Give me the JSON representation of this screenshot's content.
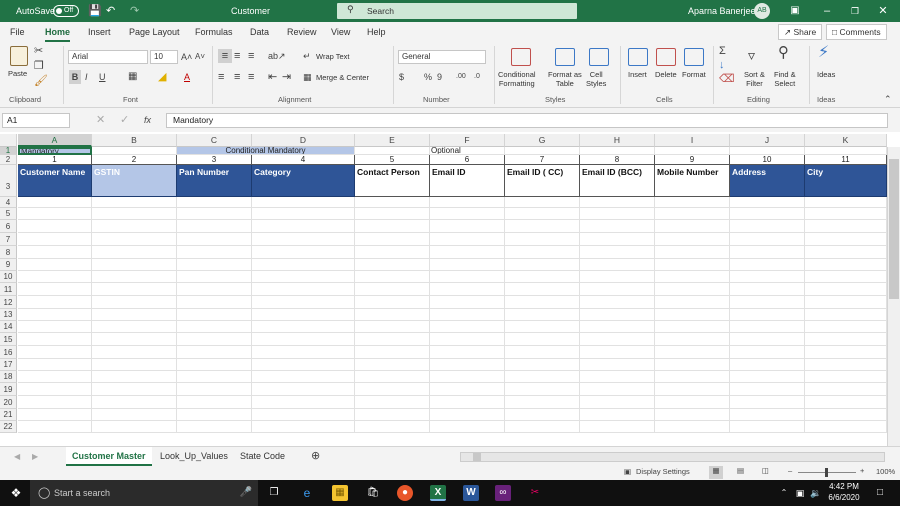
{
  "titlebar": {
    "autosave_label": "AutoSave",
    "autosave_state": "Off",
    "doc_title": "Customer",
    "search_placeholder": "Search",
    "user_name": "Aparna Banerjee",
    "user_initials": "AB"
  },
  "ribbon_tabs": [
    "File",
    "Home",
    "Insert",
    "Page Layout",
    "Formulas",
    "Data",
    "Review",
    "View",
    "Help"
  ],
  "share_label": "Share",
  "comments_label": "Comments",
  "ribbon": {
    "paste": "Paste",
    "font_name": "Arial",
    "font_size": "10",
    "wrap_text": "Wrap Text",
    "merge_center": "Merge & Center",
    "number_format": "General",
    "conditional_formatting": [
      "Conditional",
      "Formatting"
    ],
    "format_as_table": [
      "Format as",
      "Table"
    ],
    "cell_styles": [
      "Cell",
      "Styles"
    ],
    "insert": "Insert",
    "delete": "Delete",
    "format": "Format",
    "sort_filter": [
      "Sort &",
      "Filter"
    ],
    "find_select": [
      "Find &",
      "Select"
    ],
    "ideas": "Ideas",
    "groups": [
      "Clipboard",
      "Font",
      "Alignment",
      "Number",
      "Styles",
      "Cells",
      "Editing",
      "Ideas"
    ]
  },
  "formula_bar": {
    "name_box": "A1",
    "fx": "fx",
    "value": "Mandatory"
  },
  "columns": [
    "A",
    "B",
    "C",
    "D",
    "E",
    "F",
    "G",
    "H",
    "I",
    "J",
    "K"
  ],
  "rows": [
    "1",
    "2",
    "3",
    "4",
    "5",
    "6",
    "7",
    "8",
    "9",
    "10",
    "11",
    "12",
    "13",
    "14",
    "15",
    "16",
    "17",
    "18",
    "19",
    "20",
    "21",
    "22"
  ],
  "sheet": {
    "row1": {
      "a": "Mandatory",
      "cd": "Conditional Mandatory",
      "f": "Optional"
    },
    "row2": [
      "1",
      "2",
      "3",
      "4",
      "5",
      "6",
      "7",
      "8",
      "9",
      "10",
      "11"
    ],
    "row3": [
      "Customer Name",
      "GSTIN",
      "Pan Number",
      "Category",
      "Contact Person",
      "Email ID",
      "Email ID ( CC)",
      "Email ID (BCC)",
      "Mobile Number",
      "Address",
      "City"
    ]
  },
  "sheet_tabs": [
    "Customer Master",
    "Look_Up_Values",
    "State Code"
  ],
  "statusbar": {
    "display_settings": "Display Settings",
    "zoom": "100%"
  },
  "taskbar": {
    "search_placeholder": "Start a search",
    "time": "4:42 PM",
    "date": "6/6/2020"
  },
  "colors": {
    "excel_green": "#217346",
    "header_blue": "#2f5597",
    "light_blue": "#b4c6e7"
  }
}
